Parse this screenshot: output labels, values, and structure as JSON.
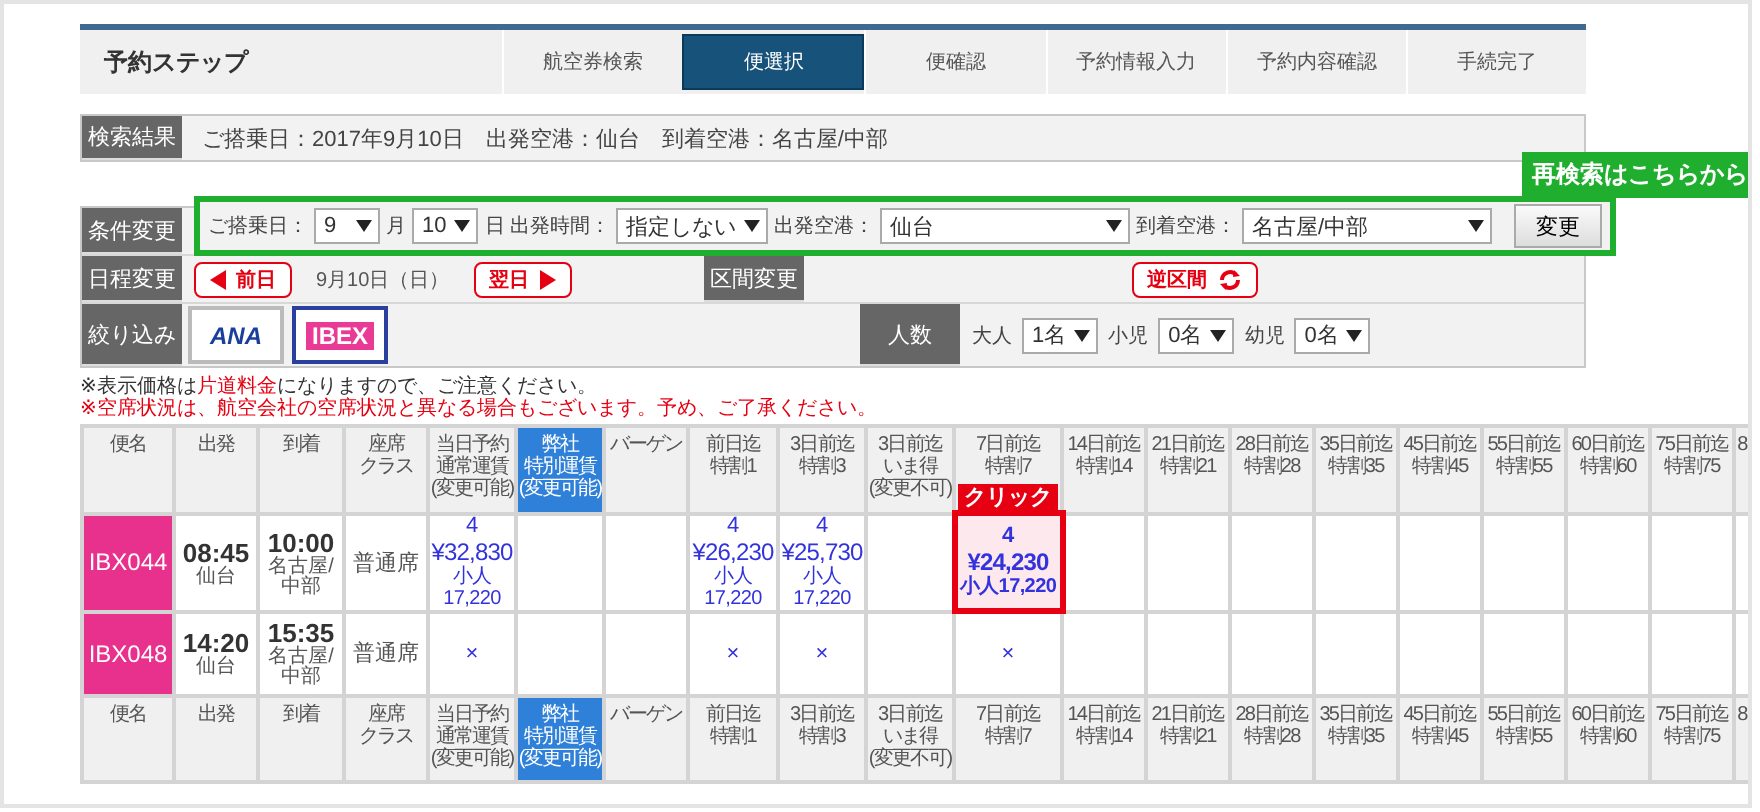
{
  "steps": {
    "title": "予約ステップ",
    "items": [
      {
        "label": "航空券検索",
        "selected": false
      },
      {
        "label": "便選択",
        "selected": true
      },
      {
        "label": "便確認",
        "selected": false
      },
      {
        "label": "予約情報入力",
        "selected": false
      },
      {
        "label": "予約内容確認",
        "selected": false
      },
      {
        "label": "手続完了",
        "selected": false
      }
    ]
  },
  "search_result": {
    "label": "検索結果",
    "text": "ご搭乗日：2017年9月10日　出発空港：仙台　到着空港：名古屋/中部"
  },
  "conditions": {
    "label": "条件変更",
    "callout": "再検索はこちらから",
    "fields": [
      {
        "kind": "label",
        "text": "ご搭乗日："
      },
      {
        "kind": "select",
        "value": "9"
      },
      {
        "kind": "label",
        "text": "月"
      },
      {
        "kind": "select",
        "value": "10"
      },
      {
        "kind": "label",
        "text": "日 出発時間："
      },
      {
        "kind": "select",
        "value": "指定しない"
      },
      {
        "kind": "label",
        "text": "出発空港："
      },
      {
        "kind": "airport",
        "value": "仙台"
      },
      {
        "kind": "label",
        "text": "到着空港："
      },
      {
        "kind": "airport",
        "value": "名古屋/中部"
      }
    ],
    "button": "変更"
  },
  "date_change": {
    "label": "日程変更",
    "prev": "前日",
    "date": "9月10日（日）",
    "next": "翌日",
    "route_label": "区間変更",
    "reverse": "逆区間"
  },
  "filter": {
    "label": "絞り込み",
    "airlines": [
      {
        "name": "ANA",
        "selected": false
      },
      {
        "name": "IBEX",
        "selected": true
      }
    ],
    "people_label": "人数",
    "people": [
      {
        "label": "大人",
        "value": "1名"
      },
      {
        "label": "小児",
        "value": "0名"
      },
      {
        "label": "幼児",
        "value": "0名"
      }
    ]
  },
  "notes": [
    {
      "kind": "info",
      "text": "※表示価格は**片道料金**になりますので、ご注意ください。"
    },
    {
      "kind": "warning",
      "text": "※空席状況は、航空会社の空席状況と異なる場合もございます。予め、ご了承ください。"
    }
  ],
  "table": {
    "columns": [
      {
        "lines": [
          "便名"
        ],
        "highlighted": false
      },
      {
        "lines": [
          "出発"
        ],
        "highlighted": false
      },
      {
        "lines": [
          "到着"
        ],
        "highlighted": false
      },
      {
        "lines": [
          "座席",
          "クラス"
        ],
        "highlighted": false
      },
      {
        "lines": [
          "当日予約",
          "通常運賃",
          "(変更可能)"
        ],
        "highlighted": false
      },
      {
        "lines": [
          "弊社",
          "特別運賃",
          "(変更可能)"
        ],
        "highlighted": true
      },
      {
        "lines": [
          "バーゲン"
        ],
        "highlighted": false
      },
      {
        "lines": [
          "前日迄",
          "特割1"
        ],
        "highlighted": false
      },
      {
        "lines": [
          "3日前迄",
          "特割3"
        ],
        "highlighted": false
      },
      {
        "lines": [
          "3日前迄",
          "いま得",
          "(変更不可)"
        ],
        "highlighted": false
      },
      {
        "lines": [
          "7日前迄",
          "特割7"
        ],
        "highlighted": false
      },
      {
        "lines": [
          "14日前迄",
          "特割14"
        ],
        "highlighted": false
      },
      {
        "lines": [
          "21日前迄",
          "特割21"
        ],
        "highlighted": false
      },
      {
        "lines": [
          "28日前迄",
          "特割28"
        ],
        "highlighted": false
      },
      {
        "lines": [
          "35日前迄",
          "特割35"
        ],
        "highlighted": false
      },
      {
        "lines": [
          "45日前迄",
          "特割45"
        ],
        "highlighted": false
      },
      {
        "lines": [
          "55日前迄",
          "特割55"
        ],
        "highlighted": false
      },
      {
        "lines": [
          "60日前迄",
          "特割60"
        ],
        "highlighted": false
      },
      {
        "lines": [
          "75日前迄",
          "特割75"
        ],
        "highlighted": false
      },
      {
        "lines": [
          "8"
        ],
        "highlighted": false
      }
    ],
    "rows": [
      {
        "flight": "IBX044",
        "dep_time": "08:45",
        "dep_airport": "仙台",
        "arr_time": "10:00",
        "arr_airport": "名古屋/中部",
        "seat_class": "普通席",
        "fares": [
          {
            "kind": "fare",
            "seats": "4",
            "price": "¥32,830",
            "child": "小人 17,220",
            "selected": false
          },
          {
            "kind": "empty"
          },
          {
            "kind": "empty"
          },
          {
            "kind": "fare",
            "seats": "4",
            "price": "¥26,230",
            "child": "小人 17,220",
            "selected": false
          },
          {
            "kind": "fare",
            "seats": "4",
            "price": "¥25,730",
            "child": "小人 17,220",
            "selected": false
          },
          {
            "kind": "empty"
          },
          {
            "kind": "fare",
            "seats": "4",
            "price": "¥24,230",
            "child": "小人17,220",
            "selected": true,
            "callout": "クリック"
          },
          {
            "kind": "empty"
          },
          {
            "kind": "empty"
          },
          {
            "kind": "empty"
          },
          {
            "kind": "empty"
          },
          {
            "kind": "empty"
          },
          {
            "kind": "empty"
          },
          {
            "kind": "empty"
          },
          {
            "kind": "empty"
          },
          {
            "kind": "empty"
          }
        ]
      },
      {
        "flight": "IBX048",
        "dep_time": "14:20",
        "dep_airport": "仙台",
        "arr_time": "15:35",
        "arr_airport": "名古屋/中部",
        "seat_class": "普通席",
        "fares": [
          {
            "kind": "none",
            "mark": "×"
          },
          {
            "kind": "empty"
          },
          {
            "kind": "empty"
          },
          {
            "kind": "none",
            "mark": "×"
          },
          {
            "kind": "none",
            "mark": "×"
          },
          {
            "kind": "empty"
          },
          {
            "kind": "none",
            "mark": "×"
          },
          {
            "kind": "empty"
          },
          {
            "kind": "empty"
          },
          {
            "kind": "empty"
          },
          {
            "kind": "empty"
          },
          {
            "kind": "empty"
          },
          {
            "kind": "empty"
          },
          {
            "kind": "empty"
          },
          {
            "kind": "empty"
          },
          {
            "kind": "empty"
          }
        ]
      }
    ],
    "footer_columns": [
      {
        "lines": [
          "便名"
        ],
        "highlighted": false
      },
      {
        "lines": [
          "出発"
        ],
        "highlighted": false
      },
      {
        "lines": [
          "到着"
        ],
        "highlighted": false
      },
      {
        "lines": [
          "座席",
          "クラス"
        ],
        "highlighted": false
      },
      {
        "lines": [
          "当日予約",
          "通常運賃",
          "(変更可能)"
        ],
        "highlighted": false
      },
      {
        "lines": [
          "弊社",
          "特別運賃",
          "(変更可能)"
        ],
        "highlighted": true
      },
      {
        "lines": [
          "バーゲン"
        ],
        "highlighted": false
      },
      {
        "lines": [
          "前日迄",
          "特割1"
        ],
        "highlighted": false
      },
      {
        "lines": [
          "3日前迄",
          "特割3"
        ],
        "highlighted": false
      },
      {
        "lines": [
          "3日前迄",
          "いま得",
          "(変更不可)"
        ],
        "highlighted": false
      },
      {
        "lines": [
          "7日前迄",
          "特割7"
        ],
        "highlighted": false
      },
      {
        "lines": [
          "14日前迄",
          "特割14"
        ],
        "highlighted": false
      },
      {
        "lines": [
          "21日前迄",
          "特割21"
        ],
        "highlighted": false
      },
      {
        "lines": [
          "28日前迄",
          "特割28"
        ],
        "highlighted": false
      },
      {
        "lines": [
          "35日前迄",
          "特割35"
        ],
        "highlighted": false
      },
      {
        "lines": [
          "45日前迄",
          "特割45"
        ],
        "highlighted": false
      },
      {
        "lines": [
          "55日前迄",
          "特割55"
        ],
        "highlighted": false
      },
      {
        "lines": [
          "60日前迄",
          "特割60"
        ],
        "highlighted": false
      },
      {
        "lines": [
          "75日前迄",
          "特割75"
        ],
        "highlighted": false
      },
      {
        "lines": [
          "8"
        ],
        "highlighted": false
      }
    ]
  }
}
